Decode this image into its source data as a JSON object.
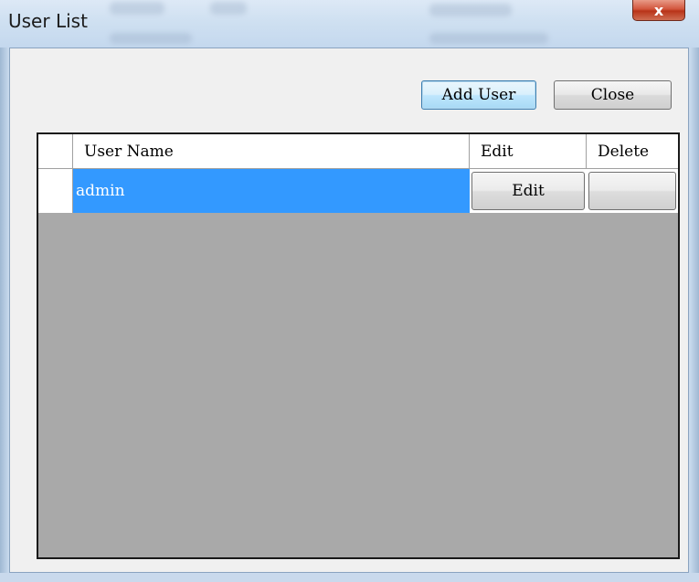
{
  "window": {
    "title": "User List",
    "close_glyph": "x"
  },
  "toolbar": {
    "add_user_label": "Add User",
    "close_label": "Close"
  },
  "grid": {
    "columns": [
      "User Name",
      "Edit",
      "Delete"
    ],
    "rows": [
      {
        "user_name": "admin",
        "edit_label": "Edit",
        "delete_label": "",
        "selected": true
      }
    ]
  },
  "colors": {
    "selection": "#3399ff",
    "empty_area": "#a9a9a9"
  }
}
